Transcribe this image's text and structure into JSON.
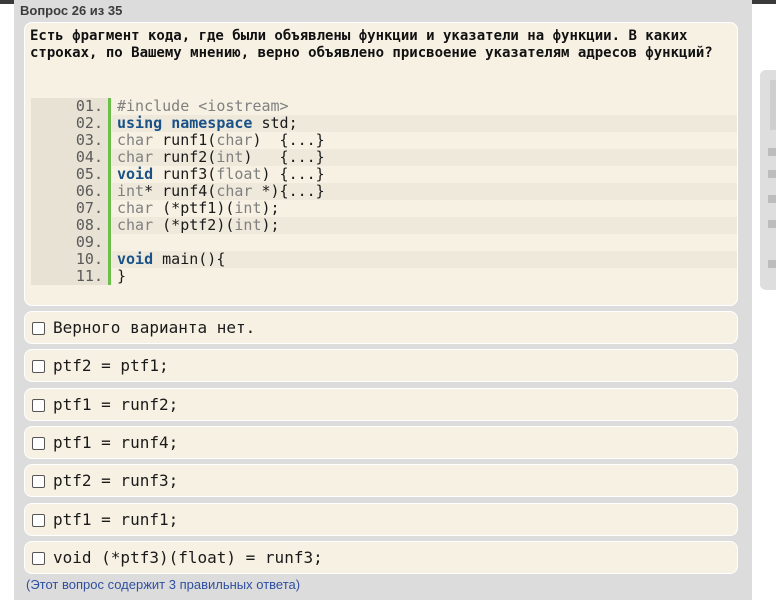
{
  "header": {
    "question_counter": "Вопрос 26 из 35"
  },
  "question": {
    "text": "Есть фрагмент кода, где были объявлены функции и указатели на функции. В каких строках, по Вашему мнению, верно объявлено присвоение указателям адресов функций?"
  },
  "code": {
    "lines": [
      {
        "num": "01.",
        "text": "#include <iostream>"
      },
      {
        "num": "02.",
        "text": "using namespace std;"
      },
      {
        "num": "03.",
        "text": "char runf1(char)  {...}"
      },
      {
        "num": "04.",
        "text": "char runf2(int)   {...}"
      },
      {
        "num": "05.",
        "text": "void runf3(float) {...}"
      },
      {
        "num": "06.",
        "text": "int* runf4(char *){...}"
      },
      {
        "num": "07.",
        "text": "char (*ptf1)(int);"
      },
      {
        "num": "08.",
        "text": "char (*ptf2)(int);"
      },
      {
        "num": "09.",
        "text": ""
      },
      {
        "num": "10.",
        "text": "void main(){"
      },
      {
        "num": "11.",
        "text": "}"
      }
    ]
  },
  "options": [
    {
      "label": "Верного варианта нет.",
      "checked": false
    },
    {
      "label": "ptf2 = ptf1;",
      "checked": false
    },
    {
      "label": "ptf1 = runf2;",
      "checked": false
    },
    {
      "label": "ptf1 = runf4;",
      "checked": false
    },
    {
      "label": "ptf2 = runf3;",
      "checked": false
    },
    {
      "label": "ptf1 = runf1;",
      "checked": false
    },
    {
      "label": "void (*ptf3)(float) = runf3;",
      "checked": false
    }
  ],
  "footer": {
    "note": "(Этот вопрос содержит 3 правильных ответа)"
  },
  "colors": {
    "card_bg": "#f7f1e4",
    "gutter_bar": "#6cc04a",
    "keyword": "#1a5287",
    "note": "#2f4f9f"
  }
}
